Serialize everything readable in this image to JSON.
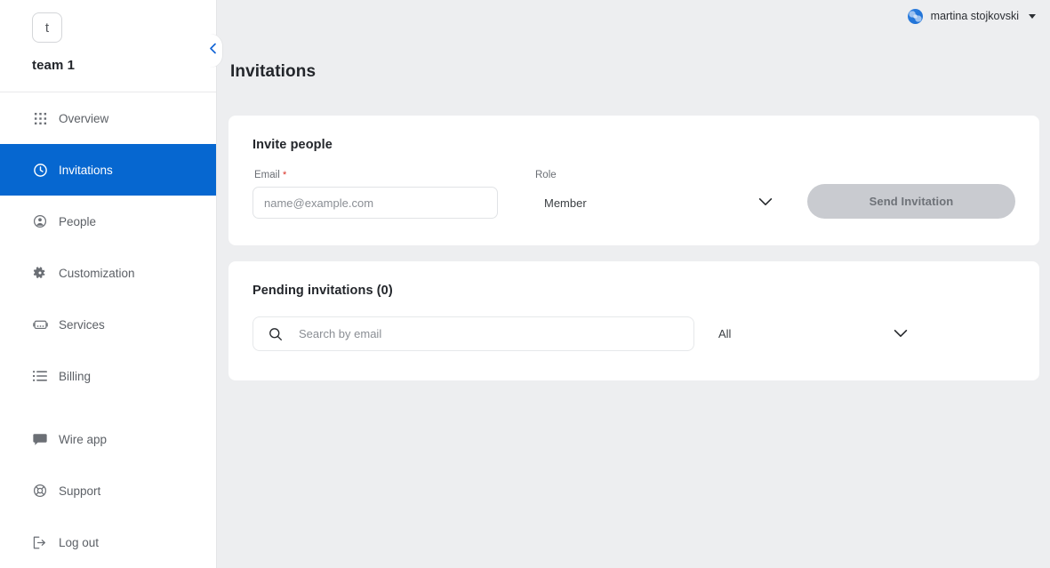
{
  "sidebar": {
    "team_logo_letter": "t",
    "team_name": "team 1",
    "collapse_icon": "chevron-left-icon",
    "items": [
      {
        "label": "Overview",
        "icon": "grid-dots-icon",
        "active": false
      },
      {
        "label": "Invitations",
        "icon": "clock-icon",
        "active": true
      },
      {
        "label": "People",
        "icon": "person-circle-icon",
        "active": false
      },
      {
        "label": "Customization",
        "icon": "gear-icon",
        "active": false
      },
      {
        "label": "Services",
        "icon": "robot-icon",
        "active": false
      },
      {
        "label": "Billing",
        "icon": "list-icon",
        "active": false
      }
    ],
    "footer_items": [
      {
        "label": "Wire app",
        "icon": "chat-bubble-icon"
      },
      {
        "label": "Support",
        "icon": "lifebuoy-icon"
      },
      {
        "label": "Log out",
        "icon": "logout-icon"
      }
    ]
  },
  "topbar": {
    "user_name": "martina stojkovski",
    "avatar": "user-avatar",
    "caret_icon": "caret-down-icon"
  },
  "page": {
    "title": "Invitations"
  },
  "invite_card": {
    "title": "Invite people",
    "email_label": "Email",
    "email_required_mark": "*",
    "email_placeholder": "name@example.com",
    "email_value": "",
    "role_label": "Role",
    "role_value": "Member",
    "role_chevron_icon": "chevron-down-icon",
    "send_label": "Send Invitation",
    "send_disabled": true
  },
  "pending_card": {
    "title": "Pending invitations (0)",
    "search_placeholder": "Search by email",
    "search_value": "",
    "search_icon": "search-icon",
    "filter_value": "All",
    "filter_chevron_icon": "chevron-down-icon"
  },
  "colors": {
    "accent": "#0667d0",
    "page_bg": "#edeef0",
    "card_bg": "#ffffff",
    "required_red": "#d93025",
    "disabled_button": "#c9cbd0"
  }
}
